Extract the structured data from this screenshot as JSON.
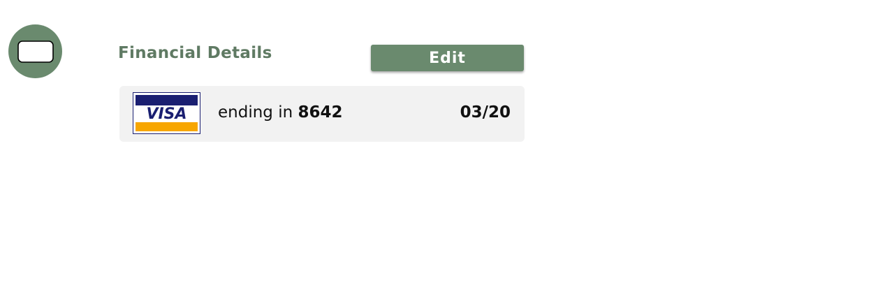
{
  "section": {
    "title": "Financial Details",
    "icon": "credit-card-icon"
  },
  "actions": {
    "edit_label": "Edit"
  },
  "payment_method": {
    "brand": "VISA",
    "ending_prefix": "ending in",
    "last4": "8642",
    "expiry": "03/20",
    "logo_icon": "visa-logo-icon"
  },
  "colors": {
    "accent": "#6a8a6e",
    "title": "#5f7a63",
    "card_row_bg": "#f2f2f2",
    "visa_blue": "#1a1f71",
    "visa_gold": "#f7a600"
  }
}
